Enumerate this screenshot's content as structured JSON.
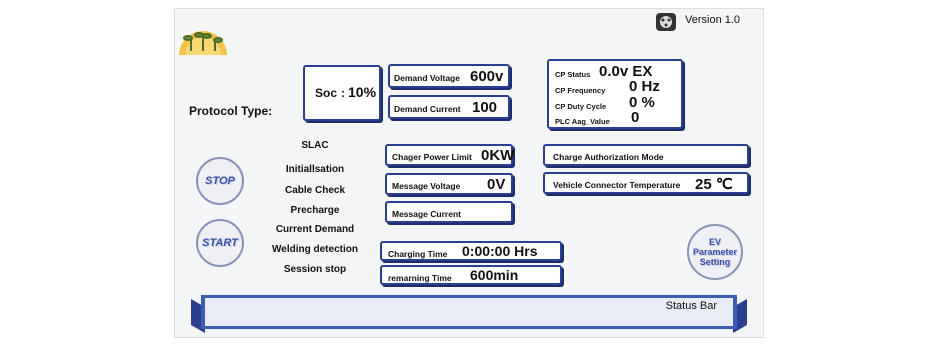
{
  "header": {
    "version": "Version 1.0",
    "logo_icon": "plant-sunrise-logo-icon",
    "connector_icon": "ev-connector-icon"
  },
  "protocol": {
    "label": "Protocol Type:"
  },
  "soc": {
    "label": "Soc",
    "separator": ":",
    "value": "10%"
  },
  "demand": {
    "voltage_label": "Demand Voltage",
    "voltage_value": "600v",
    "current_label": "Demand Current",
    "current_value": "100"
  },
  "cp": {
    "status_label": "CP Status",
    "status_value": "0.0v EX",
    "frequency_label": "CP Frequency",
    "frequency_value": "0 Hz",
    "duty_label": "CP Duty Cycle",
    "duty_value": "0 %",
    "plc_label": "PLC Aag_Value",
    "plc_value": "0"
  },
  "process_steps": [
    "SLAC",
    "Initiallsation",
    "Cable Check",
    "Precharge",
    "Current Demand",
    "Welding detection",
    "Session stop"
  ],
  "buttons": {
    "stop": "STOP",
    "start": "START",
    "ev_param": [
      "EV",
      "Parameter",
      "Setting"
    ]
  },
  "fields": {
    "charger_power_label": "Chager Power Limit",
    "charger_power_value": "0KW",
    "message_voltage_label": "Message Voltage",
    "message_voltage_value": "0V",
    "message_current_label": "Message Current",
    "charging_time_label": "Charging Time",
    "charging_time_value": "0:00:00 Hrs",
    "remaining_time_label": "remarning Time",
    "remaining_time_value": "600min",
    "auth_mode_label": "Charge Authorization Mode",
    "connector_temp_label": "Vehicle Connector Temperature",
    "connector_temp_value": "25 ℃"
  },
  "status_bar": {
    "label": "Status Bar"
  },
  "colors": {
    "accent": "#2a3f8f",
    "button_text": "#3a4fa8",
    "banner": "#3b5fb0"
  }
}
